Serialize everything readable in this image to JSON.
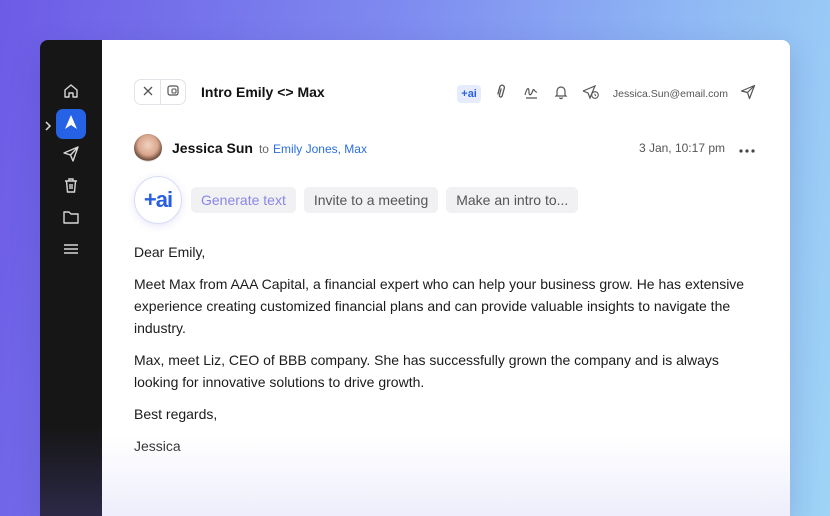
{
  "header": {
    "subject": "Intro Emily <> Max",
    "ai_chip": "+ai",
    "sender_email": "Jessica.Sun@email.com"
  },
  "message": {
    "from_name": "Jessica Sun",
    "to_word": "to",
    "to_names": "Emily Jones, Max",
    "date": "3 Jan, 10:17 pm",
    "more": "•••"
  },
  "ai": {
    "badge": "+ai",
    "suggestions": [
      "Generate text",
      "Invite to a meeting",
      "Make an intro to..."
    ]
  },
  "body": {
    "greeting": "Dear Emily,",
    "p1": "Meet Max from AAA Capital, a financial expert who can help your business grow. He has extensive experience creating customized financial plans and can provide valuable insights to navigate the industry.",
    "p2": "Max, meet Liz, CEO of BBB company. She has successfully grown the company and is always looking for innovative solutions to drive growth.",
    "closing": "Best regards,",
    "signature": "Jessica"
  },
  "sidebar": {
    "items": [
      "home-icon",
      "compose-icon",
      "send-icon",
      "trash-icon",
      "folder-icon",
      "menu-icon"
    ]
  },
  "colors": {
    "accent": "#2662e6",
    "link": "#2a6fe0",
    "sidebar_bg": "#161616",
    "generate_text": "#8a86e8"
  }
}
